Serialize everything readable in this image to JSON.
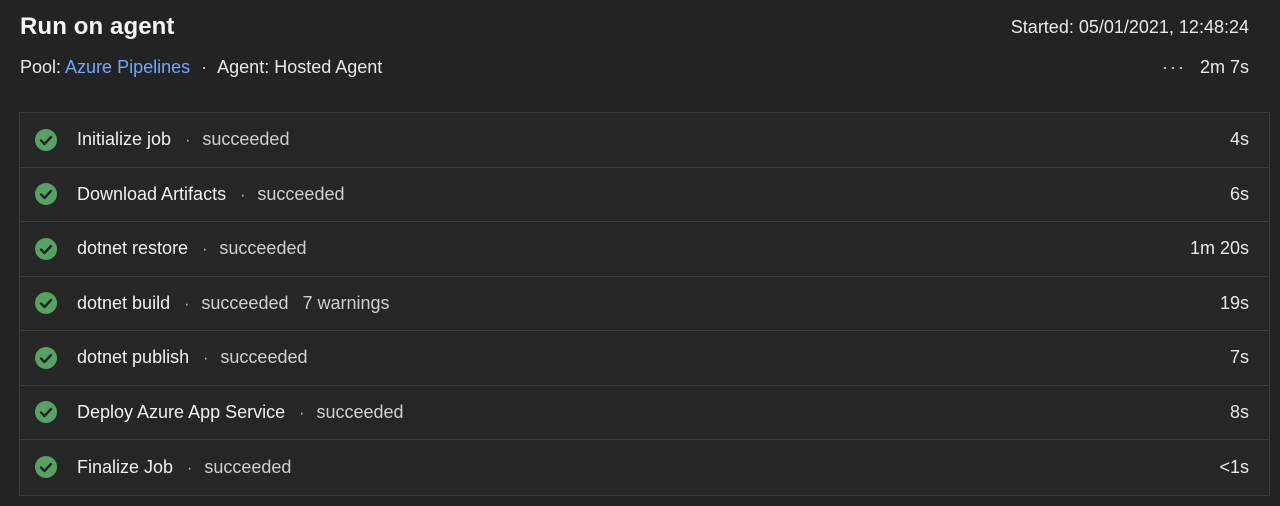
{
  "header": {
    "title": "Run on agent",
    "started": "Started: 05/01/2021, 12:48:24",
    "pool_label": "Pool:",
    "pool_link": "Azure Pipelines",
    "separator": "·",
    "agent_label": "Agent: Hosted Agent",
    "more": "···",
    "total_duration": "2m 7s"
  },
  "steps": [
    {
      "name": "Initialize job",
      "status": "succeeded",
      "extra": "",
      "duration": "4s"
    },
    {
      "name": "Download Artifacts",
      "status": "succeeded",
      "extra": "",
      "duration": "6s"
    },
    {
      "name": "dotnet restore",
      "status": "succeeded",
      "extra": "",
      "duration": "1m 20s"
    },
    {
      "name": "dotnet build",
      "status": "succeeded",
      "extra": "7 warnings",
      "duration": "19s"
    },
    {
      "name": "dotnet publish",
      "status": "succeeded",
      "extra": "",
      "duration": "7s"
    },
    {
      "name": "Deploy Azure App Service",
      "status": "succeeded",
      "extra": "",
      "duration": "8s"
    },
    {
      "name": "Finalize Job",
      "status": "succeeded",
      "extra": "",
      "duration": "<1s"
    }
  ],
  "colors": {
    "success": "#55a362",
    "link": "#6fa8ff",
    "background": "#232323"
  },
  "icons": {
    "status": "check-circle-icon",
    "more": "more-horizontal-icon"
  }
}
